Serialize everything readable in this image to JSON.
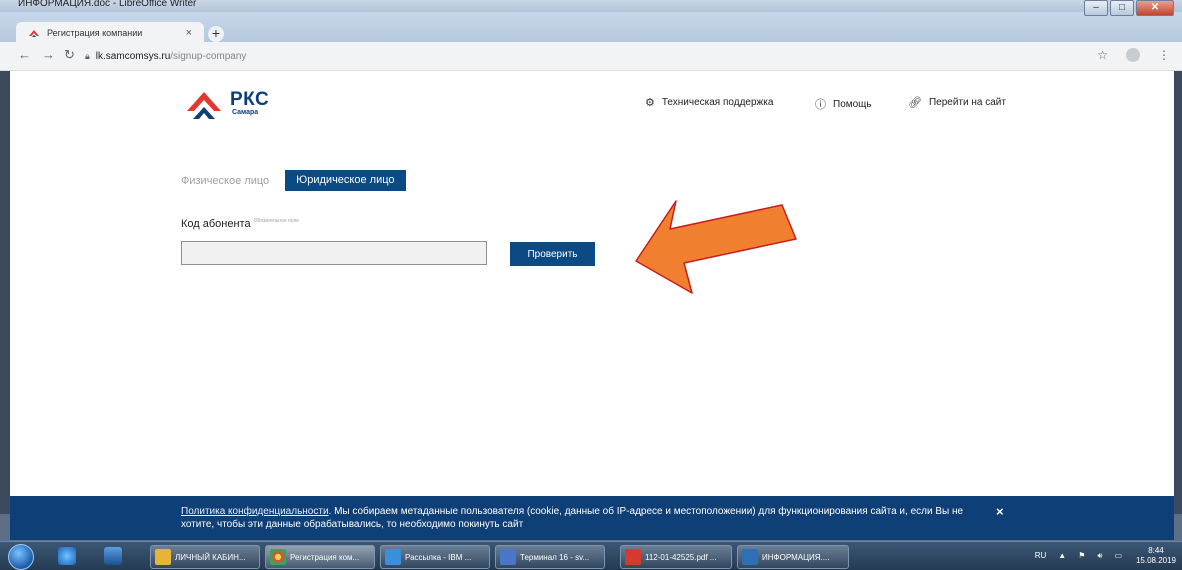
{
  "outer_window": {
    "title": "ИНФОРМАЦИЯ.doc - LibreOffice Writer"
  },
  "browser": {
    "tab_title": "Регистрация компании",
    "tab_close": "×",
    "new_tab": "+",
    "url_host": "lk.samcomsys.ru",
    "url_path": "/signup-company"
  },
  "page": {
    "logo": {
      "brand": "РКС",
      "city": "Самара"
    },
    "nav": {
      "support": "Техническая поддержка",
      "help": "Помощь",
      "site": "Перейти на сайт"
    },
    "tabs": {
      "individual": "Физическое лицо",
      "legal": "Юридическое лицо"
    },
    "form": {
      "label": "Код абонента",
      "required_note": "Обязательное поле",
      "input_value": "",
      "submit": "Проверить"
    },
    "arrow_color": "#f08030",
    "accent_color": "#0b4a82"
  },
  "cookie_banner": {
    "link": "Политика конфиденциальности",
    "text": ". Мы собираем метаданные пользователя (cookie, данные об IP-адресе и местоположении) для функционирования сайта и, если Вы не хотите, чтобы эти данные обрабатывались, то необходимо покинуть сайт",
    "close": "×"
  },
  "taskbar": {
    "items": [
      {
        "label": "ЛИЧНЫЙ КАБИН...",
        "color": "#e5b53a"
      },
      {
        "label": "Регистрация ком...",
        "color": "#e8453c"
      },
      {
        "label": "Рассылка - IBM ...",
        "color": "#3a8fd8"
      },
      {
        "label": "Терминал 16 - sv...",
        "color": "#4a76c6"
      },
      {
        "label": "112-01-42525.pdf ...",
        "color": "#d43a2f"
      },
      {
        "label": "ИНФОРМАЦИЯ....",
        "color": "#2f6fb8"
      }
    ],
    "lang": "RU",
    "time": "8:44",
    "date": "15.08.2019"
  }
}
